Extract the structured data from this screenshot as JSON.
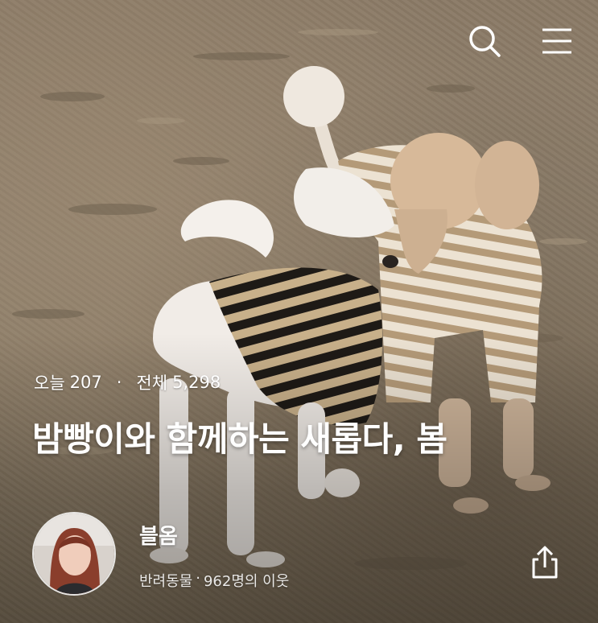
{
  "header": {
    "search_icon": "search-icon",
    "menu_icon": "hamburger-menu-icon"
  },
  "stats": {
    "today_label": "오늘",
    "today_value": "207",
    "separator": "·",
    "total_label": "전체",
    "total_value": "5,298"
  },
  "post": {
    "title": "밤빵이와 함께하는 새롭다, 봄"
  },
  "blogger": {
    "name": "블옴",
    "category": "반려동물",
    "meta_separator": "·",
    "neighbors": "962명의 이웃"
  },
  "actions": {
    "share_icon": "share-icon"
  },
  "colors": {
    "text": "#ffffff",
    "ground": "#8a7a66"
  }
}
